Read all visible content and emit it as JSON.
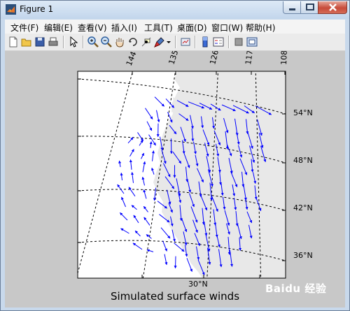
{
  "window": {
    "title": "Figure 1"
  },
  "menu": [
    {
      "key": "file",
      "label": "文件(F)"
    },
    {
      "key": "edit",
      "label": "编辑(E)"
    },
    {
      "key": "view",
      "label": "查看(V)"
    },
    {
      "key": "insert",
      "label": "插入(I)"
    },
    {
      "key": "tools",
      "label": "工具(T)"
    },
    {
      "key": "desktop",
      "label": "桌面(D)"
    },
    {
      "key": "window",
      "label": "窗口(W)"
    },
    {
      "key": "help",
      "label": "帮助(H)"
    }
  ],
  "toolbar": {
    "icons": [
      "new-figure-icon",
      "open-file-icon",
      "save-icon",
      "print-icon",
      "pointer-icon",
      "zoom-in-icon",
      "zoom-out-icon",
      "pan-hand-icon",
      "rotate-3d-icon",
      "data-cursor-icon",
      "brush-icon",
      "dropdown-arrow-icon",
      "link-plot-icon",
      "colorbar-icon",
      "legend-icon",
      "hide-plot-tools-icon",
      "show-plot-tools-icon"
    ]
  },
  "map": {
    "meridian_labels": [
      "144°W",
      "135",
      "126",
      "117",
      "108"
    ],
    "parallel_labels": [
      "54°N",
      "48°N",
      "42°N",
      "36°N",
      "30°N"
    ],
    "land_color": "#e8e8e8",
    "ocean_color": "#ffffff",
    "arrow_color": "#0000ff",
    "caption": "Simulated surface winds"
  },
  "watermark": {
    "text": "Baidu 经验"
  }
}
